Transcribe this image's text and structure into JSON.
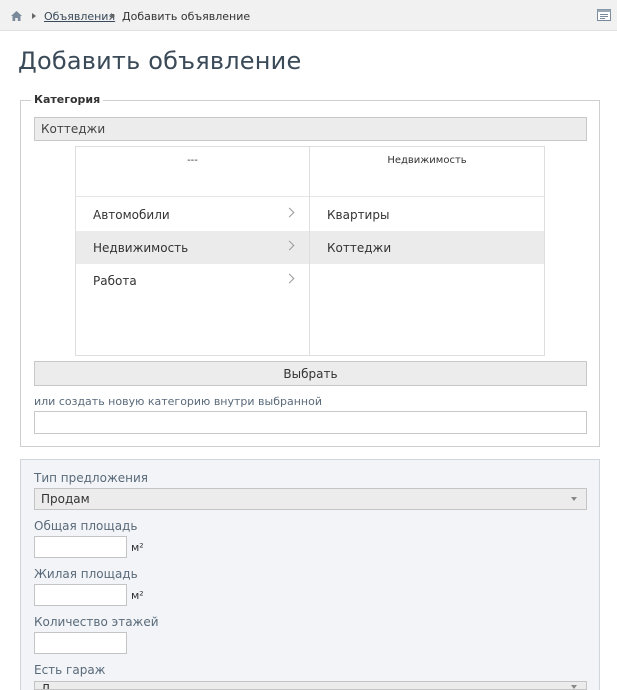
{
  "breadcrumb": {
    "home_icon": "home-icon",
    "link": "Объявления",
    "current": "Добавить объявление",
    "panel_icon": "panel-toggle-icon"
  },
  "page": {
    "title": "Добавить объявление"
  },
  "category": {
    "legend": "Категория",
    "selected_value": "Коттеджи",
    "columns": [
      {
        "header": "---",
        "items": [
          {
            "label": "Автомобили",
            "has_children": true,
            "selected": false
          },
          {
            "label": "Недвижимость",
            "has_children": true,
            "selected": true
          },
          {
            "label": "Работа",
            "has_children": true,
            "selected": false
          }
        ]
      },
      {
        "header": "Недвижимость",
        "items": [
          {
            "label": "Квартиры",
            "has_children": false,
            "selected": false
          },
          {
            "label": "Коттеджи",
            "has_children": false,
            "selected": true
          }
        ]
      }
    ],
    "select_button": "Выбрать",
    "new_category_label": "или создать новую категорию внутри выбранной",
    "new_category_value": ""
  },
  "properties": {
    "offer_type": {
      "label": "Тип предложения",
      "value": "Продам"
    },
    "total_area": {
      "label": "Общая площадь",
      "value": "",
      "unit": "м²"
    },
    "living_area": {
      "label": "Жилая площадь",
      "value": "",
      "unit": "м²"
    },
    "floors": {
      "label": "Количество этажей",
      "value": ""
    },
    "garage": {
      "label": "Есть гараж",
      "value": "Д"
    }
  },
  "colors": {
    "title": "#3b4a58",
    "label": "#5a6a7a",
    "props_bg": "#f2f4f7",
    "selected_row": "#ebebeb"
  }
}
